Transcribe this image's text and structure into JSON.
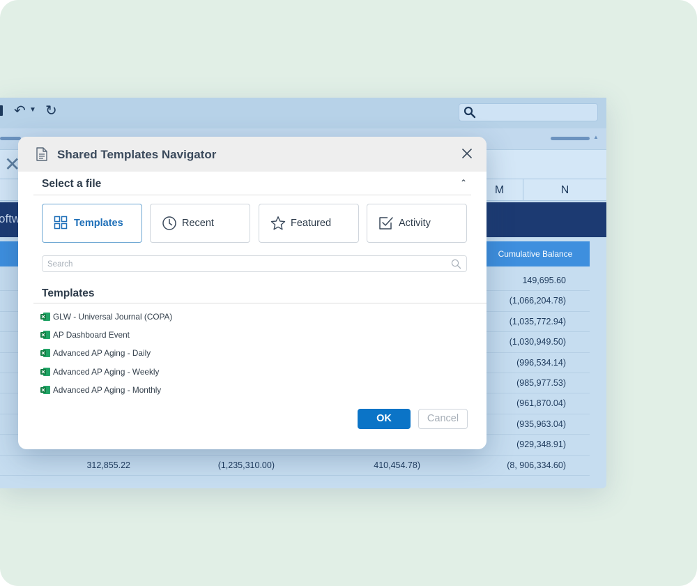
{
  "spreadsheet": {
    "columns": [
      "M",
      "N"
    ],
    "banner_text": "oftw",
    "balance_header": "Cumulative Balance",
    "balances": [
      "149,695.60",
      "(1,066,204.78)",
      "(1,035,772.94)",
      "(1,030,949.50)",
      "(996,534.14)",
      "(985,977.53)",
      "(961,870.04)",
      "(935,963.04)",
      "(929,348.91)",
      "(8, 906,334.60)"
    ],
    "last_row": [
      "312,855.22",
      "(1,235,310.00)",
      "410,454.78)"
    ]
  },
  "dialog": {
    "title": "Shared Templates Navigator",
    "section_title": "Select a file",
    "tabs": [
      {
        "label": "Templates",
        "icon": "grid-icon",
        "active": true
      },
      {
        "label": "Recent",
        "icon": "clock-icon",
        "active": false
      },
      {
        "label": "Featured",
        "icon": "star-icon",
        "active": false
      },
      {
        "label": "Activity",
        "icon": "checkbox-icon",
        "active": false
      }
    ],
    "search_placeholder": "Search",
    "list_title": "Templates",
    "files": [
      "GLW - Universal Journal (COPA)",
      "AP Dashboard Event",
      "Advanced AP Aging - Daily",
      "Advanced AP Aging - Weekly",
      "Advanced AP Aging - Monthly"
    ],
    "ok_label": "OK",
    "cancel_label": "Cancel"
  },
  "colors": {
    "accent": "#0b74c7",
    "active_tab": "#1e6fb8",
    "banner": "#1c3a72",
    "header_cell": "#3e8fde",
    "background": "#e1efe6"
  }
}
